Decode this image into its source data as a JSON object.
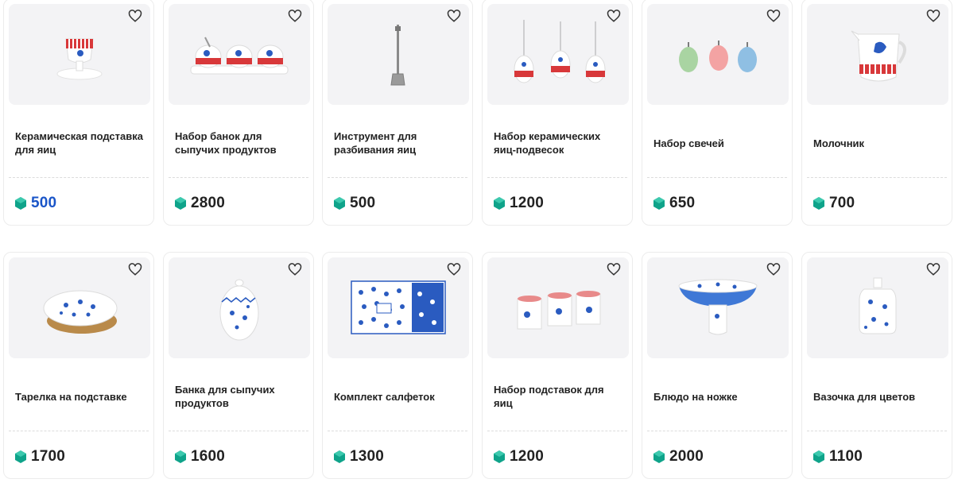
{
  "colors": {
    "accent": "#1a55c8",
    "gem": "#0fa38a",
    "card_border": "#ececec",
    "image_bg": "#f3f3f5"
  },
  "products": [
    {
      "title": "Керамическая подставка для яиц",
      "price": "500",
      "icon": "egg-cup-image",
      "highlight": true
    },
    {
      "title": "Набор банок для сыпучих продуктов",
      "price": "2800",
      "icon": "jars-set-image",
      "highlight": false
    },
    {
      "title": "Инструмент для разбивания яиц",
      "price": "500",
      "icon": "egg-cracker-image",
      "highlight": false
    },
    {
      "title": "Набор керамических яиц-подвесок",
      "price": "1200",
      "icon": "hanging-eggs-image",
      "highlight": false
    },
    {
      "title": "Набор свечей",
      "price": "650",
      "icon": "candles-image",
      "highlight": false
    },
    {
      "title": "Молочник",
      "price": "700",
      "icon": "milk-jug-image",
      "highlight": false
    },
    {
      "title": "Тарелка на подставке",
      "price": "1700",
      "icon": "plate-on-stand-image",
      "highlight": false
    },
    {
      "title": "Банка для сыпучих продуктов",
      "price": "1600",
      "icon": "storage-jar-image",
      "highlight": false
    },
    {
      "title": "Комплект салфеток",
      "price": "1300",
      "icon": "napkins-set-image",
      "highlight": false
    },
    {
      "title": "Набор подставок для яиц",
      "price": "1200",
      "icon": "egg-cups-set-image",
      "highlight": false
    },
    {
      "title": "Блюдо на ножке",
      "price": "2000",
      "icon": "footed-dish-image",
      "highlight": false
    },
    {
      "title": "Вазочка для цветов",
      "price": "1100",
      "icon": "flower-vase-image",
      "highlight": false
    }
  ]
}
